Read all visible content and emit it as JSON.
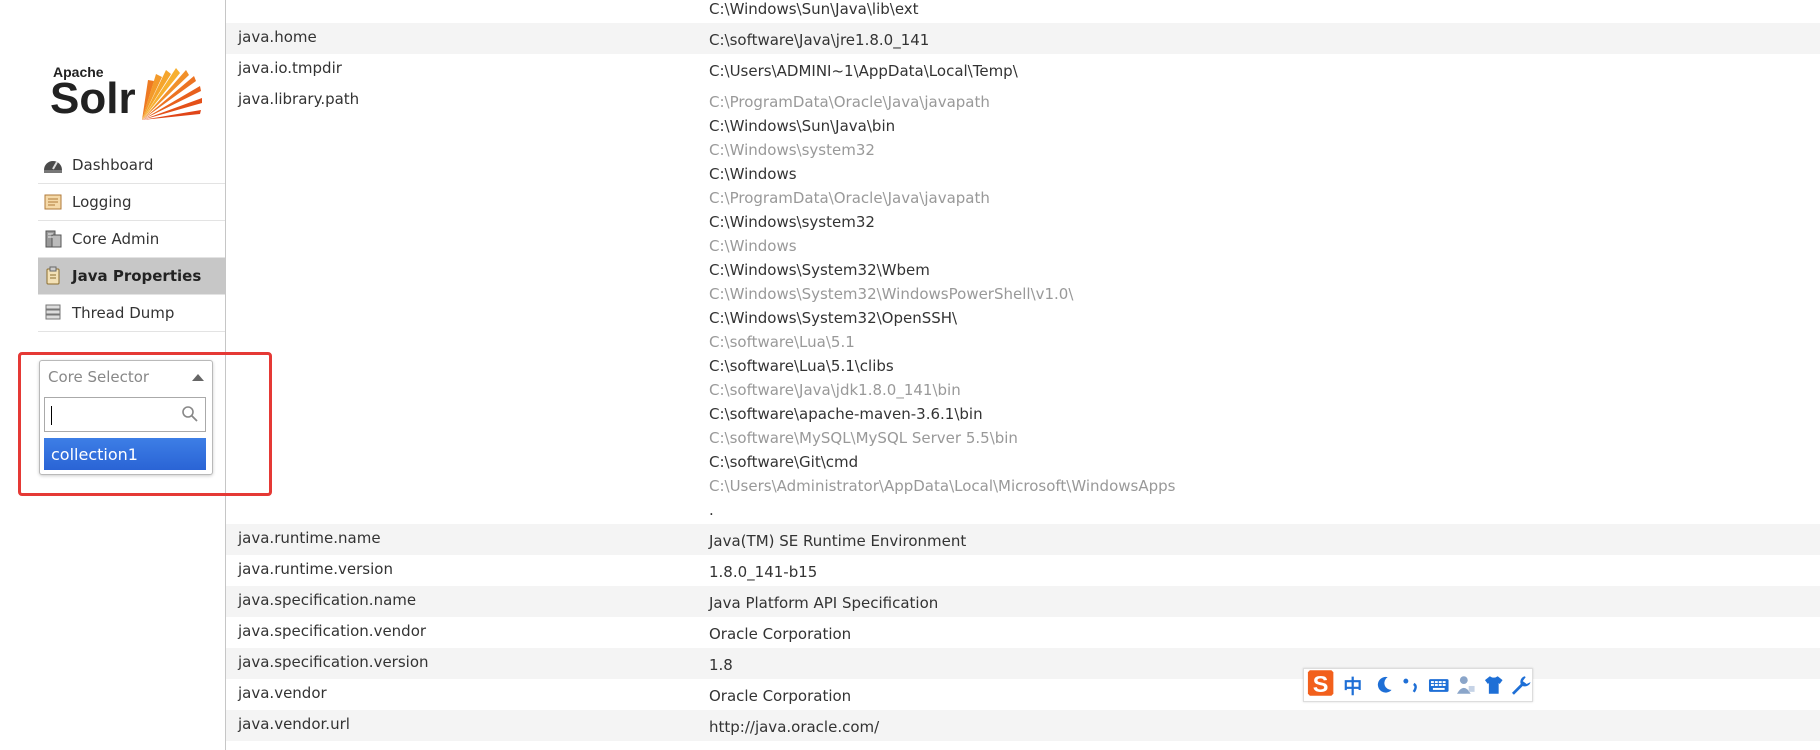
{
  "logo": {
    "apache": "Apache",
    "solr": "Solr"
  },
  "menu": [
    {
      "label": "Dashboard",
      "icon": "dashboard-icon",
      "active": false
    },
    {
      "label": "Logging",
      "icon": "logging-icon",
      "active": false
    },
    {
      "label": "Core Admin",
      "icon": "core-admin-icon",
      "active": false
    },
    {
      "label": "Java Properties",
      "icon": "java-properties-icon",
      "active": true
    },
    {
      "label": "Thread Dump",
      "icon": "thread-dump-icon",
      "active": false
    }
  ],
  "core_selector": {
    "label": "Core Selector",
    "search_value": "",
    "options": [
      "collection1"
    ]
  },
  "properties": [
    {
      "key": "",
      "values": [
        "C:\\Windows\\Sun\\Java\\lib\\ext"
      ],
      "striped": false
    },
    {
      "key": "java.home",
      "values": [
        "C:\\software\\Java\\jre1.8.0_141"
      ],
      "striped": true
    },
    {
      "key": "java.io.tmpdir",
      "values": [
        "C:\\Users\\ADMINI~1\\AppData\\Local\\Temp\\"
      ],
      "striped": false
    },
    {
      "key": "java.library.path",
      "values": [
        "C:\\ProgramData\\Oracle\\Java\\javapath",
        "C:\\Windows\\Sun\\Java\\bin",
        "C:\\Windows\\system32",
        "C:\\Windows",
        "C:\\ProgramData\\Oracle\\Java\\javapath",
        "C:\\Windows\\system32",
        "C:\\Windows",
        "C:\\Windows\\System32\\Wbem",
        "C:\\Windows\\System32\\WindowsPowerShell\\v1.0\\",
        "C:\\Windows\\System32\\OpenSSH\\",
        "C:\\software\\Lua\\5.1",
        "C:\\software\\Lua\\5.1\\clibs",
        "C:\\software\\Java\\jdk1.8.0_141\\bin",
        "C:\\software\\apache-maven-3.6.1\\bin",
        "C:\\software\\MySQL\\MySQL Server 5.5\\bin",
        "C:\\software\\Git\\cmd",
        "C:\\Users\\Administrator\\AppData\\Local\\Microsoft\\WindowsApps",
        "."
      ],
      "striped": false
    },
    {
      "key": "java.runtime.name",
      "values": [
        "Java(TM) SE Runtime Environment"
      ],
      "striped": true
    },
    {
      "key": "java.runtime.version",
      "values": [
        "1.8.0_141-b15"
      ],
      "striped": false
    },
    {
      "key": "java.specification.name",
      "values": [
        "Java Platform API Specification"
      ],
      "striped": true
    },
    {
      "key": "java.specification.vendor",
      "values": [
        "Oracle Corporation"
      ],
      "striped": false
    },
    {
      "key": "java.specification.version",
      "values": [
        "1.8"
      ],
      "striped": true
    },
    {
      "key": "java.vendor",
      "values": [
        "Oracle Corporation"
      ],
      "striped": false
    },
    {
      "key": "java.vendor.url",
      "values": [
        "http://java.oracle.com/"
      ],
      "striped": true
    }
  ],
  "ime_toolbar": {
    "mode_label": "中",
    "icons": [
      "sogou-logo-icon",
      "moon-icon",
      "punctuation-icon",
      "keyboard-icon",
      "user-icon",
      "shirt-icon",
      "wrench-icon"
    ]
  },
  "colors": {
    "accent": "#2a64d5",
    "highlight": "#e53935",
    "active_menu": "#c7c7c7"
  }
}
